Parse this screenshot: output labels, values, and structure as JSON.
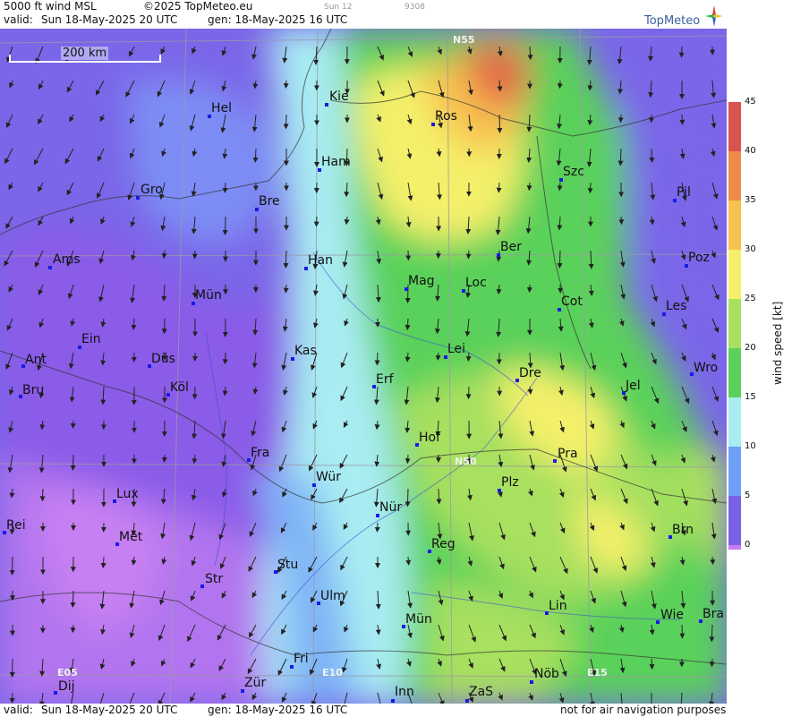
{
  "header": {
    "product": "5000 ft wind MSL",
    "copyright": "©2025 TopMeteo.eu",
    "valid_prefix": "valid:",
    "valid_value": "Sun  18-May-2025  20 UTC",
    "gen_value": "gen: 18-May-2025 16 UTC",
    "run_label": "Sun 12",
    "code": "9308"
  },
  "logo_text": "TopMeteo",
  "footer": {
    "valid_prefix": "valid:",
    "valid_value": "Sun  18-May-2025  20 UTC",
    "gen_value": "gen: 18-May-2025 16 UTC",
    "disclaimer": "not for air navigation purposes"
  },
  "scale_label": "200 km",
  "grid_labels": {
    "n55": "N55",
    "n50": "N50",
    "e05": "E05",
    "e10": "E10",
    "e15": "E15"
  },
  "cities": {
    "kie": "Kie",
    "hel": "Hel",
    "ros": "Ros",
    "ham": "Ham",
    "szc": "Szc",
    "gro": "Gro",
    "bre": "Bre",
    "pil": "Pil",
    "ber": "Ber",
    "ams": "Ams",
    "han": "Han",
    "poz": "Poz",
    "mag": "Mag",
    "loc": "Loc",
    "mun_de": "Mün",
    "cot": "Cot",
    "les": "Les",
    "ein": "Ein",
    "kas": "Kas",
    "lei": "Lei",
    "ant": "Ant",
    "dus": "Düs",
    "wro": "Wro",
    "erf": "Erf",
    "dre": "Dre",
    "bru": "Bru",
    "kol": "Köl",
    "jel": "Jel",
    "hof": "Hof",
    "fra": "Fra",
    "pra": "Pra",
    "wur": "Wür",
    "lux": "Lux",
    "plz": "Plz",
    "nur": "Nür",
    "rei": "Rei",
    "met": "Met",
    "brn": "Brn",
    "reg": "Reg",
    "stu": "Stu",
    "str": "Str",
    "ulm": "Ulm",
    "lin": "Lin",
    "mun": "Mün",
    "wie": "Wie",
    "bra": "Bra",
    "fri": "Fri",
    "nob": "Nöb",
    "dij": "Dij",
    "zur": "Zür",
    "inn": "Inn",
    "zas": "ZaS"
  },
  "legend": {
    "unit_label": "wind speed  [kt]",
    "ticks": [
      "45",
      "40",
      "35",
      "30",
      "25",
      "20",
      "15",
      "10",
      "5",
      "0"
    ],
    "colors": [
      "#d9534f",
      "#f08a4b",
      "#f7c14f",
      "#f4f06a",
      "#a8e05f",
      "#5ad15a",
      "#a9ecf2",
      "#6f9ef7",
      "#7b61e8",
      "#c77df0"
    ]
  }
}
